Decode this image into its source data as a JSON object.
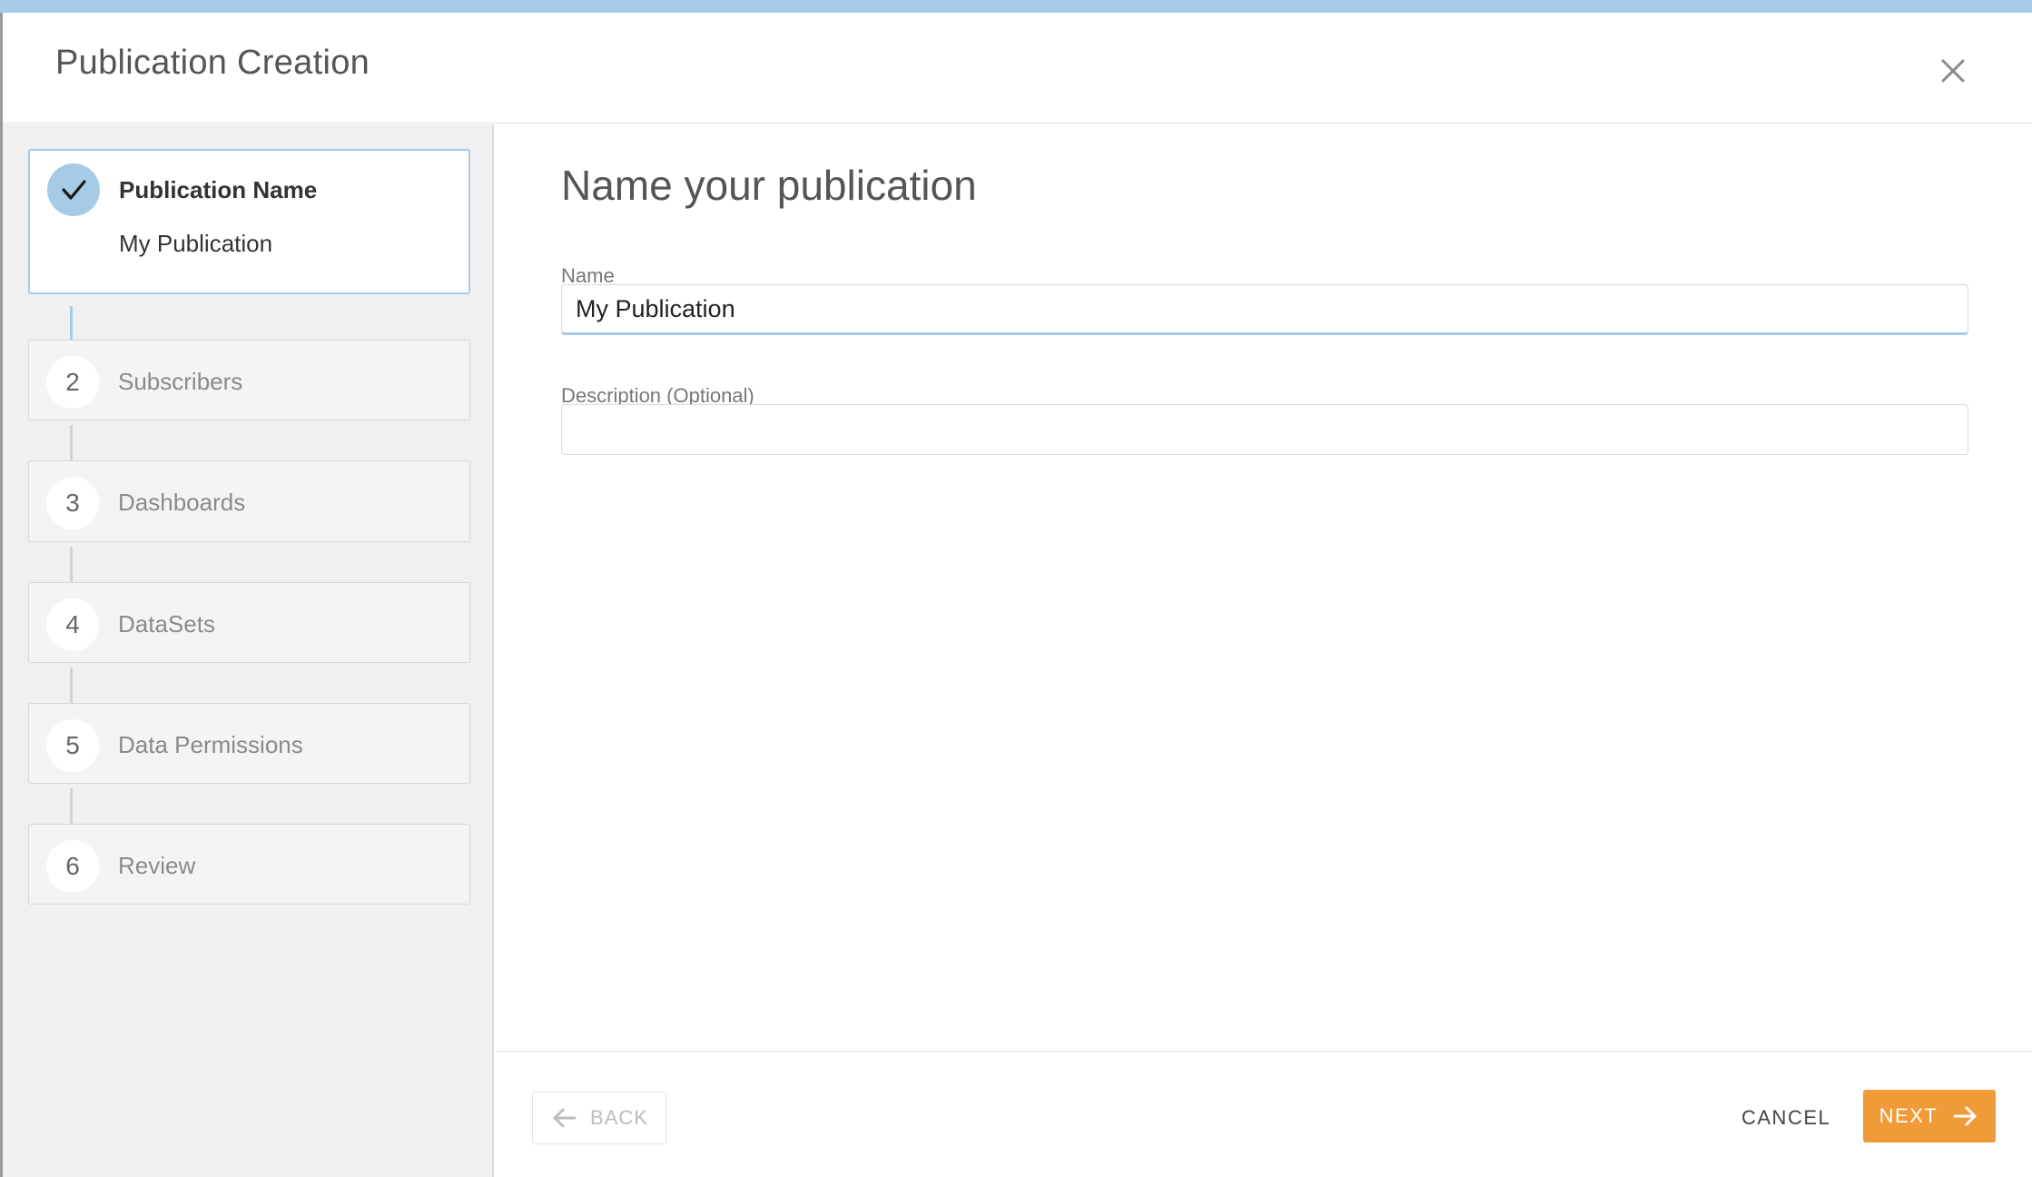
{
  "modal": {
    "title": "Publication Creation",
    "close_icon": "close-icon"
  },
  "steps": [
    {
      "number": "1",
      "label": "Publication Name",
      "value": "My Publication",
      "state": "completed",
      "icon": "checkmark-icon"
    },
    {
      "number": "2",
      "label": "Subscribers",
      "state": "pending"
    },
    {
      "number": "3",
      "label": "Dashboards",
      "state": "pending"
    },
    {
      "number": "4",
      "label": "DataSets",
      "state": "pending"
    },
    {
      "number": "5",
      "label": "Data Permissions",
      "state": "pending"
    },
    {
      "number": "6",
      "label": "Review",
      "state": "pending"
    }
  ],
  "main": {
    "heading": "Name your publication",
    "name_label": "Name",
    "name_value": "My Publication",
    "description_label": "Description (Optional)",
    "description_value": ""
  },
  "footer": {
    "back_label": "BACK",
    "back_icon": "arrow-left-icon",
    "cancel_label": "CANCEL",
    "next_label": "NEXT",
    "next_icon": "arrow-right-icon"
  },
  "colors": {
    "accent_blue": "#a6cbe6",
    "next_orange": "#f19a38",
    "sidebar_bg": "#f0f0f0"
  }
}
